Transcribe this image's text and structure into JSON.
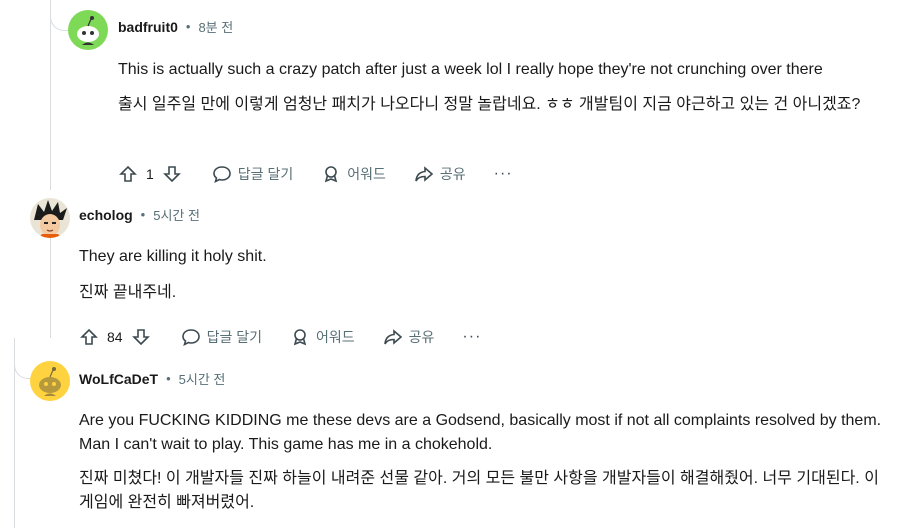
{
  "comments": [
    {
      "author": "badfruit0",
      "time": "8분 전",
      "text_en": "This is actually such a crazy patch after just a week lol I really hope they're not crunching over there",
      "text_ko": "출시 일주일 만에 이렇게 엄청난 패치가 나오다니 정말 놀랍네요. ㅎㅎ 개발팀이 지금 야근하고 있는 건 아니겠죠?",
      "votes": "1",
      "reply_label": "답글 달기",
      "award_label": "어워드",
      "share_label": "공유",
      "more_label": "···",
      "avatar_color": "#7ed957"
    },
    {
      "author": "echolog",
      "time": "5시간 전",
      "text_en": "They are killing it holy shit.",
      "text_ko": "진짜 끝내주네.",
      "votes": "84",
      "reply_label": "답글 달기",
      "award_label": "어워드",
      "share_label": "공유",
      "more_label": "···",
      "avatar_color": "#2e7d32"
    },
    {
      "author": "WoLfCaDeT",
      "time": "5시간 전",
      "text_en": "Are you FUCKING KIDDING me these devs are a Godsend, basically most if not all complaints resolved by them. Man I can't wait to play. This game has me in a chokehold.",
      "text_ko": "진짜 미쳤다! 이 개발자들 진짜 하늘이 내려준 선물 같아. 거의 모든 불만 사항을 개발자들이 해결해줬어. 너무 기대된다. 이 게임에 완전히 빠져버렸어.",
      "avatar_color": "#ffd23f"
    }
  ],
  "separator": "•"
}
